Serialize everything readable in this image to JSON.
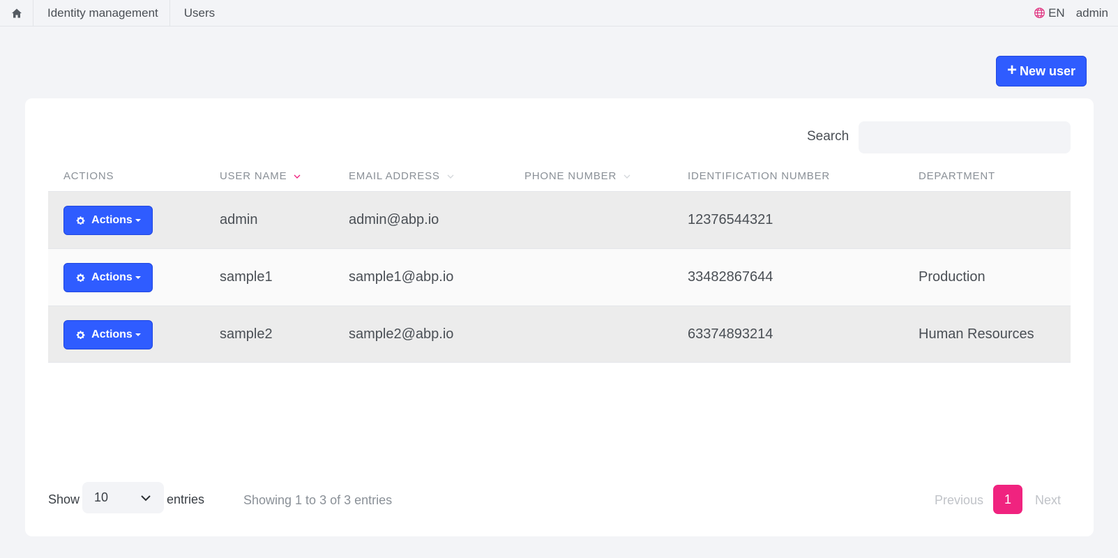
{
  "breadcrumb": {
    "items": [
      {
        "label": "Identity management"
      },
      {
        "label": "Users"
      }
    ]
  },
  "topbar": {
    "language": "EN",
    "user": "admin"
  },
  "toolbar": {
    "new_user_label": "New user",
    "accent_color": "#2f5cff"
  },
  "search": {
    "label": "Search",
    "value": ""
  },
  "table": {
    "columns": [
      {
        "label": "ACTIONS"
      },
      {
        "label": "USER NAME",
        "sort": "descending"
      },
      {
        "label": "EMAIL ADDRESS",
        "sort": "sortable"
      },
      {
        "label": "PHONE NUMBER",
        "sort": "sortable"
      },
      {
        "label": "IDENTIFICATION NUMBER"
      },
      {
        "label": "DEPARTMENT"
      }
    ],
    "rows": [
      {
        "actions": "Actions",
        "username": "admin",
        "email": "admin@abp.io",
        "phone": "",
        "id_number": "12376544321",
        "department": ""
      },
      {
        "actions": "Actions",
        "username": "sample1",
        "email": "sample1@abp.io",
        "phone": "",
        "id_number": "33482867644",
        "department": "Production"
      },
      {
        "actions": "Actions",
        "username": "sample2",
        "email": "sample2@abp.io",
        "phone": "",
        "id_number": "63374893214",
        "department": "Human Resources"
      }
    ]
  },
  "footer": {
    "show_label": "Show",
    "page_length": "10",
    "entries_label": "entries",
    "info": "Showing 1 to 3 of 3 entries",
    "pagination": {
      "previous": "Previous",
      "current": "1",
      "next": "Next",
      "active_color": "#f0237f"
    }
  }
}
